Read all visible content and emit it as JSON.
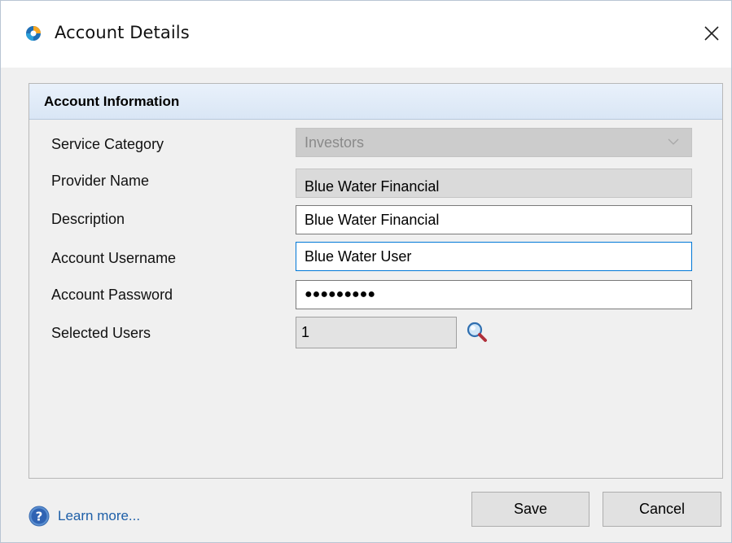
{
  "window": {
    "title": "Account Details"
  },
  "section": {
    "title": "Account Information"
  },
  "form": {
    "service_category": {
      "label": "Service Category",
      "value": "Investors"
    },
    "provider_name": {
      "label": "Provider Name",
      "value": "Blue Water Financial"
    },
    "description": {
      "label": "Description",
      "value": "Blue Water Financial"
    },
    "account_username": {
      "label": "Account Username",
      "value": "Blue Water User"
    },
    "account_password": {
      "label": "Account Password",
      "value": "●●●●●●●●●"
    },
    "selected_users": {
      "label": "Selected Users",
      "value": "1"
    }
  },
  "footer": {
    "help_label": "Learn more...",
    "save_label": "Save",
    "cancel_label": "Cancel"
  },
  "colors": {
    "accent": "#0078d7",
    "link": "#1e5fa8",
    "header_bg": "#dce8f6"
  }
}
